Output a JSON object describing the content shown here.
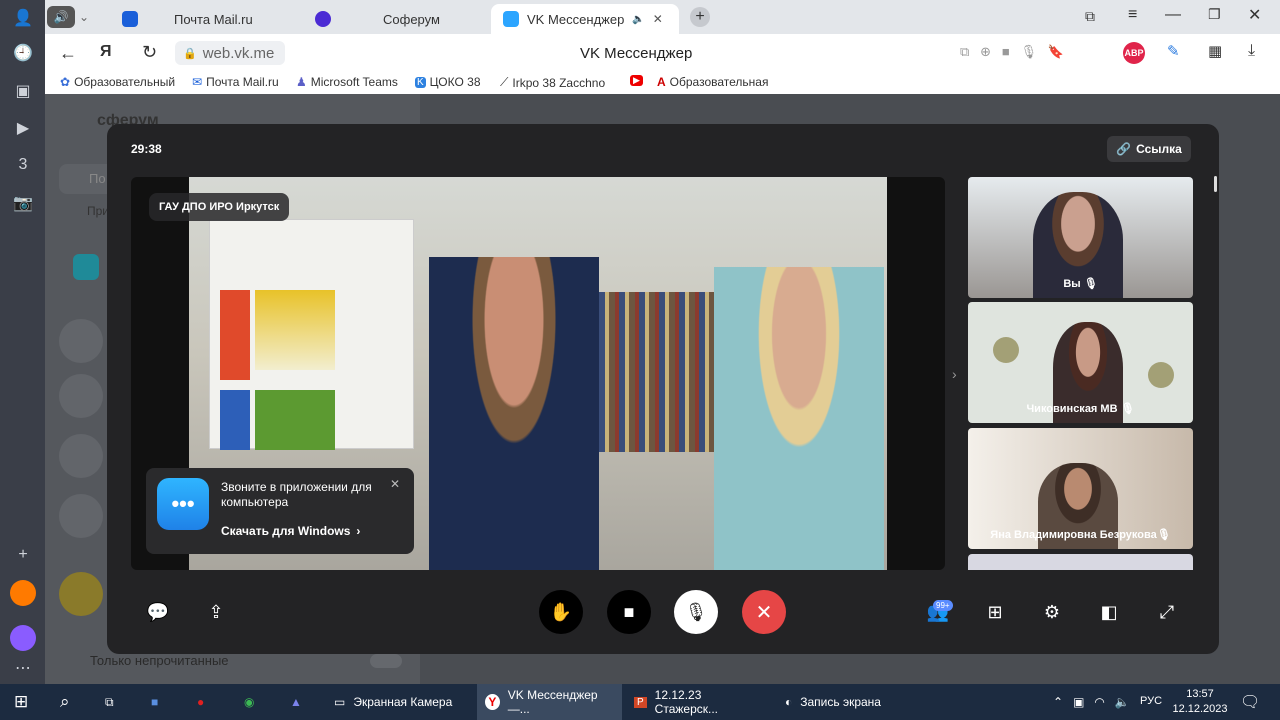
{
  "tabs": [
    {
      "label": "Почта Mail.ru"
    },
    {
      "label": "Соферум"
    },
    {
      "label": "VK Мессенджер"
    }
  ],
  "address": {
    "url": "web.vk.me",
    "page_title": "VK Мессенджер",
    "badge": "АВР"
  },
  "bookmarks": [
    "Образовательный",
    "Почта Mail.ru",
    "Microsoft Teams",
    "ЦОКО 38",
    "Irkpo 38 Zacchno",
    "",
    "Образовательная"
  ],
  "sidebar": {
    "brand": "сферум",
    "search": "По",
    "section": "При",
    "unread_label": "Только непрочитанные"
  },
  "call": {
    "timer": "29:38",
    "link_button": "Ссылка",
    "speaker_label": "ГАУ ДПО ИРО Иркутск",
    "participants": [
      {
        "name": "Вы"
      },
      {
        "name": "Чиковинская МВ"
      },
      {
        "name": "Яна Владимировна Безрукова"
      }
    ],
    "badge_count": "99+",
    "promo": {
      "text": "Звоните в приложении для компьютера",
      "link": "Скачать для Windows"
    }
  },
  "taskbar": {
    "apps": [
      {
        "label": "Экранная Камера"
      },
      {
        "label": "VK Мессенджер —..."
      },
      {
        "label": "12.12.23 Стажерск..."
      },
      {
        "label": "Запись экрана"
      }
    ],
    "lang": "РУС",
    "time": "13:57",
    "date": "12.12.2023"
  }
}
